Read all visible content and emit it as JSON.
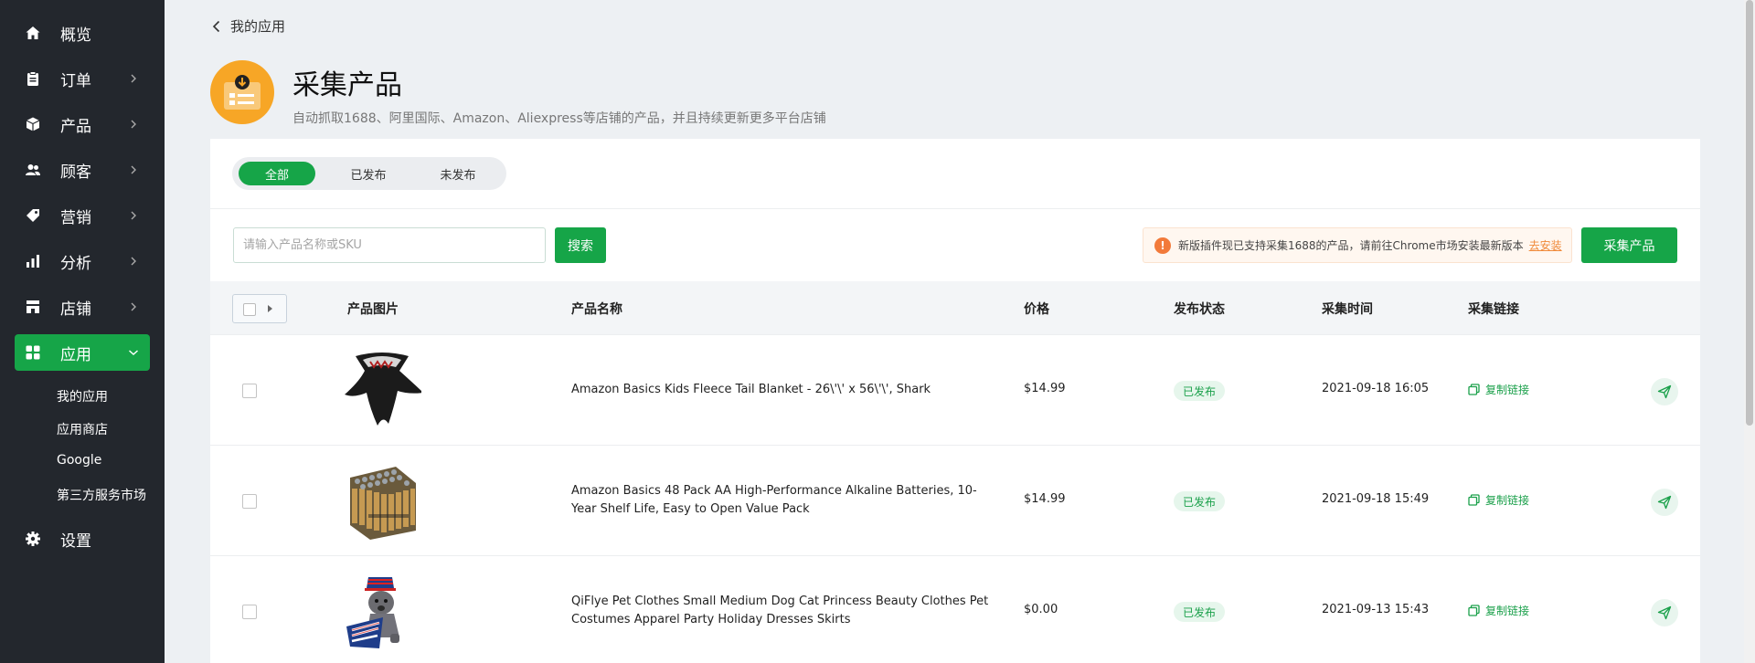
{
  "sidebar": {
    "items": [
      {
        "label": "概览",
        "icon": "home-icon"
      },
      {
        "label": "订单",
        "icon": "clipboard-icon"
      },
      {
        "label": "产品",
        "icon": "box-icon"
      },
      {
        "label": "顾客",
        "icon": "users-icon"
      },
      {
        "label": "营销",
        "icon": "tag-icon"
      },
      {
        "label": "分析",
        "icon": "bar-chart-icon"
      },
      {
        "label": "店铺",
        "icon": "store-icon"
      },
      {
        "label": "应用",
        "icon": "apps-icon"
      },
      {
        "label": "设置",
        "icon": "gear-icon"
      }
    ],
    "subitems": [
      "我的应用",
      "应用商店",
      "Google",
      "第三方服务市场"
    ],
    "active_color": "#16a548"
  },
  "breadcrumb": {
    "label": "我的应用"
  },
  "header": {
    "title": "采集产品",
    "subtitle": "自动抓取1688、阿里国际、Amazon、Aliexpress等店铺的产品，并且持续更新更多平台店铺",
    "icon": "download-app-icon"
  },
  "tabs": [
    {
      "label": "全部",
      "active": true
    },
    {
      "label": "已发布",
      "active": false
    },
    {
      "label": "未发布",
      "active": false
    }
  ],
  "search": {
    "placeholder": "请输入产品名称或SKU",
    "value": "",
    "button_label": "搜索"
  },
  "notice": {
    "text": "新版插件现已支持采集1688的产品，请前往Chrome市场安装最新版本",
    "link": "去安装"
  },
  "collect_button_label": "采集产品",
  "table": {
    "headers": [
      "产品图片",
      "产品名称",
      "价格",
      "发布状态",
      "采集时间",
      "采集链接"
    ],
    "rows": [
      {
        "name": "Amazon Basics Kids Fleece Tail Blanket - 26\\'\\' x 56\\'\\', Shark",
        "price": "$14.99",
        "status": "已发布",
        "time": "2021-09-18 16:05",
        "link": "复制链接",
        "image": "shark-blanket"
      },
      {
        "name": "Amazon Basics 48 Pack AA High-Performance Alkaline Batteries, 10-Year Shelf Life, Easy to Open Value Pack",
        "price": "$14.99",
        "status": "已发布",
        "time": "2021-09-18 15:49",
        "link": "复制链接",
        "image": "batteries"
      },
      {
        "name": "QiFlye Pet Clothes Small Medium Dog Cat Princess Beauty Clothes Pet Costumes Apparel Party Holiday Dresses Skirts",
        "price": "$0.00",
        "status": "已发布",
        "time": "2021-09-13 15:43",
        "link": "复制链接",
        "image": "dog-costume"
      }
    ]
  }
}
